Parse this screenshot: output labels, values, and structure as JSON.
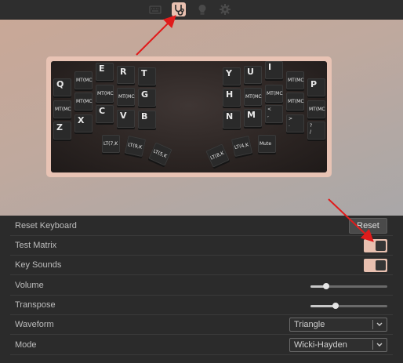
{
  "toolbar": {
    "icons": [
      "keyboard-icon",
      "stethoscope-icon",
      "lightbulb-icon",
      "gear-icon"
    ],
    "accent": "#e9c0b0"
  },
  "keyboard": {
    "left_keys": [
      "Q",
      "MT(MC",
      "E",
      "R",
      "T",
      "MT(MC",
      "MT(MC",
      "MT(MC",
      "G",
      "MT(MC",
      "X",
      "C",
      "V",
      "B",
      "Z"
    ],
    "right_keys": [
      "Y",
      "U",
      "I",
      "MT(MC",
      "P",
      "H",
      "MT(MC",
      "MT(MC",
      "MT(MC",
      "MT(MC",
      "N",
      "M",
      "<\n,",
      ">\n.",
      "?\n/"
    ],
    "thumb_keys": [
      "LT(7,K",
      "LT(9,K",
      "LT(5,K",
      "LT(8,K",
      "LT(4,K",
      "Mute"
    ]
  },
  "settings": {
    "reset_keyboard": {
      "label": "Reset Keyboard",
      "button": "Reset"
    },
    "test_matrix": {
      "label": "Test Matrix",
      "on": true
    },
    "key_sounds": {
      "label": "Key Sounds",
      "on": true
    },
    "volume": {
      "label": "Volume",
      "value": 0.2
    },
    "transpose": {
      "label": "Transpose",
      "value": 0.33
    },
    "waveform": {
      "label": "Waveform",
      "value": "Triangle"
    },
    "mode": {
      "label": "Mode",
      "value": "Wicki-Hayden"
    }
  },
  "colors": {
    "panel_bg": "#2b2b2b",
    "toggle_on": "#e8c0b0",
    "annotation": "#e01b1b"
  }
}
